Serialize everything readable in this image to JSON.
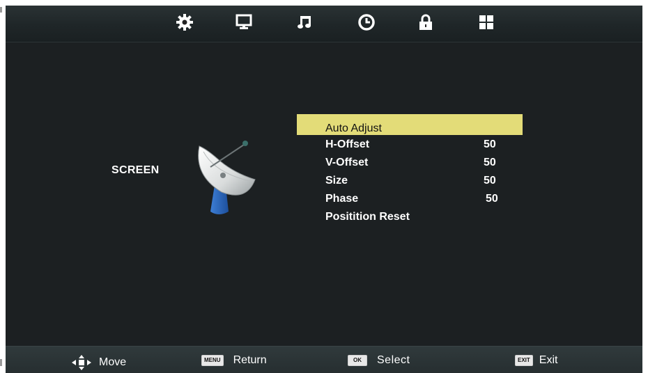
{
  "top_tabs": [
    {
      "icon": "gear-icon"
    },
    {
      "icon": "monitor-icon"
    },
    {
      "icon": "music-note-icon"
    },
    {
      "icon": "clock-icon"
    },
    {
      "icon": "lock-icon"
    },
    {
      "icon": "grid-icon"
    }
  ],
  "section_label": "SCREEN",
  "section_icon": "satellite-dish-icon",
  "menu": {
    "items": [
      {
        "label": "Auto Adjust",
        "value": ""
      },
      {
        "label": "H-Offset",
        "value": "50"
      },
      {
        "label": "V-Offset",
        "value": "50"
      },
      {
        "label": "Size",
        "value": "50"
      },
      {
        "label": "Phase",
        "value": "50"
      },
      {
        "label": "Positition Reset",
        "value": ""
      }
    ],
    "highlight_color": "#e3dc78"
  },
  "footer": {
    "move": {
      "label": "Move",
      "icon": "direction-pad-icon"
    },
    "return": {
      "key": "MENU",
      "label": "Return"
    },
    "select": {
      "key": "OK",
      "label": "Select"
    },
    "exit": {
      "key": "EXIT",
      "label": "Exit"
    }
  }
}
